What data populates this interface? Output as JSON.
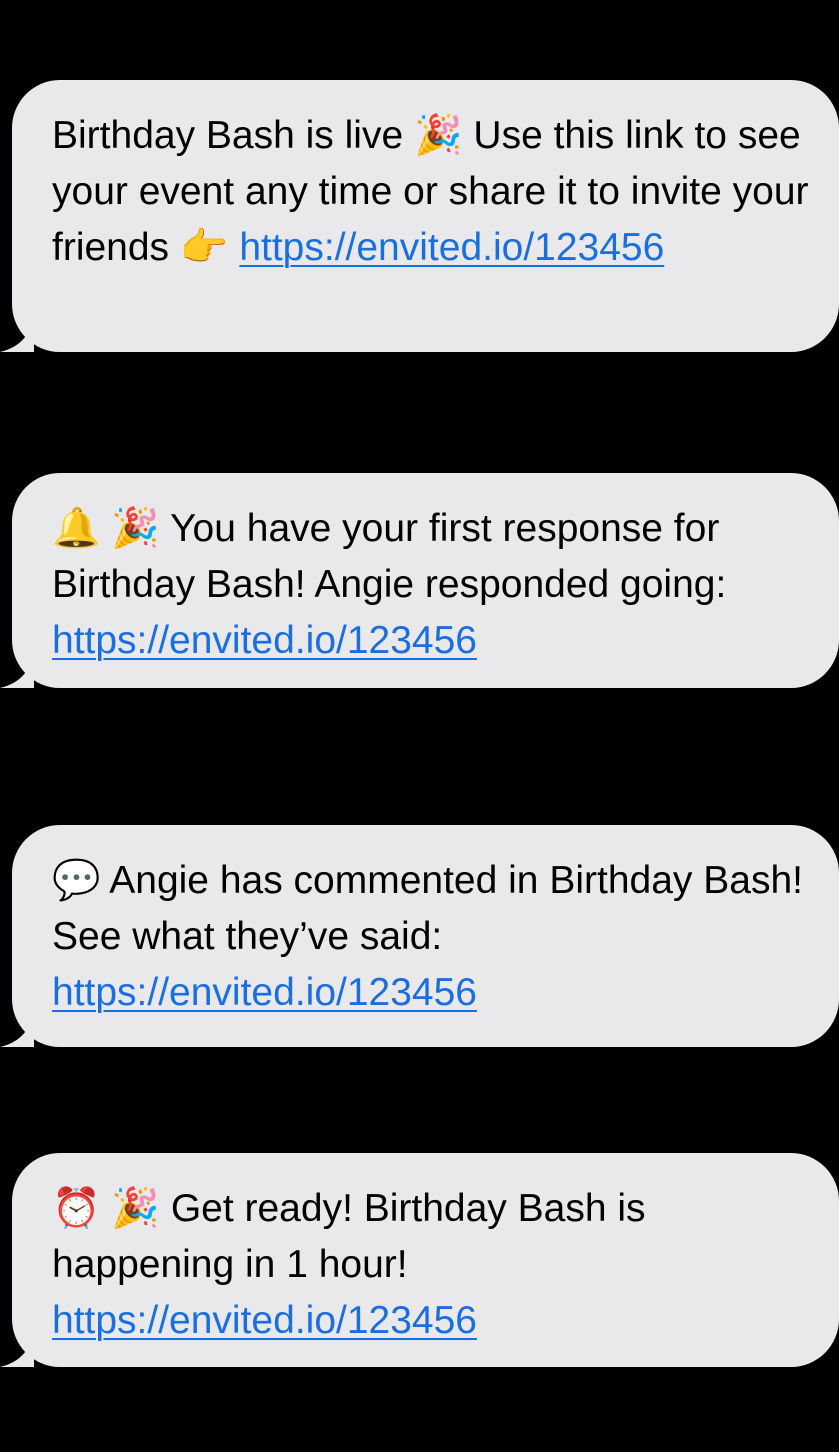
{
  "messages": [
    {
      "lead_emoji": "",
      "text_before": "Birthday Bash is live ",
      "mid_emoji": "🎉",
      "text_mid": " Use this link to see your event any time or share it to invite your friends ",
      "end_emoji": "👉",
      "link": "https://envited.io/123456",
      "lead_icons": []
    },
    {
      "lead_icons": [
        "bell-icon",
        "party-popper-icon"
      ],
      "text": "You have your first response for Birthday Bash! Angie responded going: ",
      "link": "https://envited.io/123456"
    },
    {
      "lead_icons": [
        "speech-bubble-icon"
      ],
      "text": "Angie has commented in Birthday Bash! See what they’ve said: ",
      "link": "https://envited.io/123456"
    },
    {
      "lead_icons": [
        "alarm-clock-icon",
        "party-popper-icon"
      ],
      "text": "Get ready! Birthday Bash is happening in 1 hour! ",
      "link": "https://envited.io/123456"
    }
  ],
  "icons": {
    "m2_first": "🔔",
    "m2_second": "🎉",
    "m3_first": "💬",
    "m4_first": "⏰",
    "m4_second": "🎉"
  },
  "colors": {
    "bubble": "#e9e9eb",
    "link": "#1a6fe0",
    "background": "#000000"
  }
}
